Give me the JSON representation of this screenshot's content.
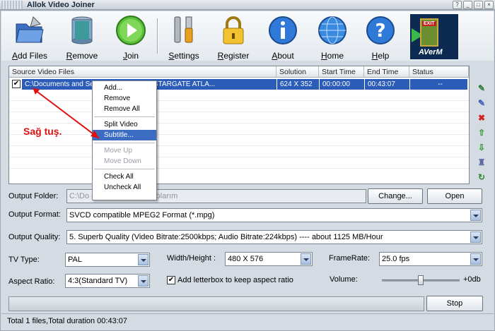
{
  "window": {
    "title": "Allok Video Joiner"
  },
  "toolbar": {
    "add_files": "Add Files",
    "remove": "Remove",
    "join": "Join",
    "settings": "Settings",
    "register": "Register",
    "about": "About",
    "home": "Home",
    "help": "Help"
  },
  "ad": {
    "brand": "AVerM",
    "exit_sign": "EXIT"
  },
  "filelist": {
    "columns": [
      "Source Video Files",
      "Solution",
      "Start Time",
      "End Time",
      "Status"
    ],
    "rows": [
      {
        "checked": true,
        "file": "C:\\Documents and Settings\\...\\Belgelerim\\Videolarım\\STARGATE ATLA...",
        "file_left": "C:\\Documents and Se",
        "file_right": "gelerim\\Videolarım\\STARGATE ATLA...",
        "solution": "624 X 352",
        "start": "00:00:00",
        "end": "00:43:07",
        "status": "--"
      }
    ]
  },
  "context_menu": {
    "add": "Add...",
    "remove": "Remove",
    "remove_all": "Remove All",
    "split_video": "Split Video",
    "subtitle": "Subtitle...",
    "move_up": "Move Up",
    "move_down": "Move Down",
    "check_all": "Check All",
    "uncheck_all": "Uncheck All"
  },
  "annotation": {
    "text": "Sağ tuş.",
    "color": "#e01010"
  },
  "form": {
    "output_folder_label": "Output Folder:",
    "output_folder_value": "C:\\Do                    gs          Belgelerim\\Videolarım",
    "change_button": "Change...",
    "open_button": "Open",
    "output_format_label": "Output Format:",
    "output_format_value": "SVCD compatible MPEG2 Format (*.mpg)",
    "output_quality_label": "Output Quality:",
    "output_quality_value": "5. Superb  Quality  (Video Bitrate:2500kbps;   Audio Bitrate:224kbps)  ----  about 1125 MB/Hour",
    "tv_type_label": "TV Type:",
    "tv_type_value": "PAL",
    "width_height_label": "Width/Height :",
    "width_height_value": "480 X 576",
    "framerate_label": "FrameRate:",
    "framerate_value": "25.0   fps",
    "aspect_ratio_label": "Aspect Ratio:",
    "aspect_ratio_value": "4:3(Standard TV)",
    "letterbox_label": "Add letterbox to keep aspect ratio",
    "letterbox_checked": true,
    "volume_label": "Volume:",
    "volume_value": "+0db",
    "volume_level": 0.5
  },
  "stop_button": "Stop",
  "status": {
    "text": "Total 1 files,Total duration 00:43:07"
  },
  "colors": {
    "selection": "#2b5cb8",
    "menu_highlight": "#3c6cc2",
    "accent_red": "#e01010"
  }
}
